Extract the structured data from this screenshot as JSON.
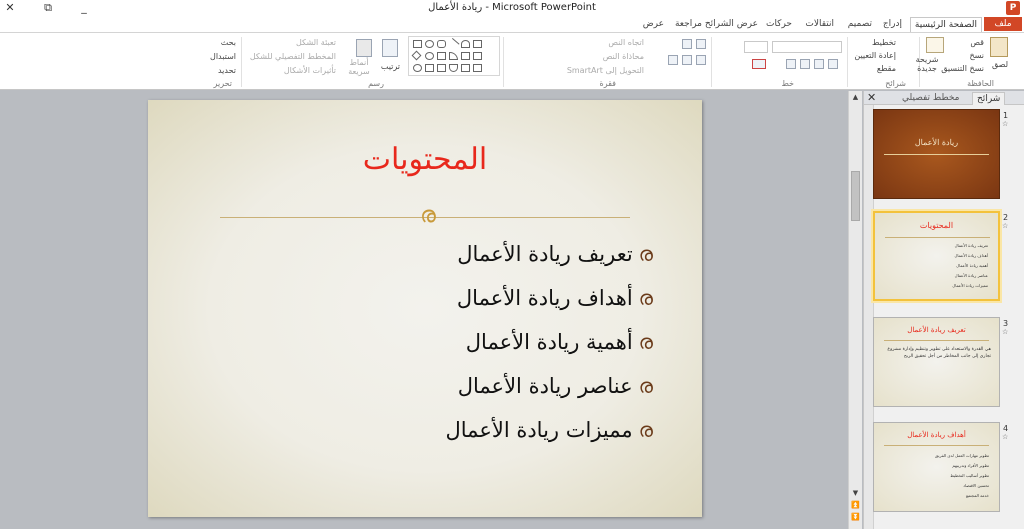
{
  "window": {
    "title": "ريادة الأعمال - Microsoft PowerPoint",
    "app_icon_letter": "P",
    "close_glyph": "✕",
    "restore_glyph": "⧉",
    "minimize_glyph": "_"
  },
  "tabs": [
    "ملف",
    "الصفحة الرئيسية",
    "إدراج",
    "تصميم",
    "انتقالات",
    "حركات",
    "عرض الشرائح",
    "مراجعة",
    "عرض"
  ],
  "ribbon": {
    "clipboard": {
      "label": "الحافظة",
      "paste": "لصق",
      "cut": "قص",
      "copy": "نسخ",
      "format_painter": "نسخ التنسيق"
    },
    "slides": {
      "label": "شرائح",
      "new_slide": "شريحة جديدة",
      "layout": "تخطيط",
      "reset": "إعادة التعيين",
      "section": "مقطع"
    },
    "font": {
      "label": "خط"
    },
    "paragraph": {
      "label": "فقرة",
      "text_direction": "اتجاه النص",
      "align_text": "محاذاة النص",
      "smartart": "التحويل إلى SmartArt"
    },
    "drawing": {
      "label": "رسم",
      "arrange": "ترتيب",
      "quick_styles": "أنماط سريعة",
      "shape_fill": "تعبئة الشكل",
      "shape_outline": "المخطط التفصيلي للشكل",
      "shape_effects": "تأثيرات الأشكال"
    },
    "editing": {
      "label": "تحرير",
      "find": "بحث",
      "replace": "استبدال",
      "select": "تحديد"
    }
  },
  "slide": {
    "title": "المحتويات",
    "ornament": "ര",
    "bullet_glyph": "ര",
    "bullets": [
      "تعريف ريادة الأعمال",
      "أهداف ريادة الأعمال",
      "أهمية ريادة الأعمال",
      "عناصر ريادة الأعمال",
      "مميزات ريادة الأعمال"
    ]
  },
  "pane": {
    "tab_slides": "شرائح",
    "tab_outline": "مخطط تفصيلي",
    "close_glyph": "✕",
    "thumbnails": [
      {
        "num": "1",
        "title": "ريادة الأعمال"
      },
      {
        "num": "2",
        "title": "المحتويات",
        "items": [
          "تعريف ريادة الأعمال",
          "أهداف ريادة الأعمال",
          "أهمية ريادة الأعمال",
          "عناصر ريادة الأعمال",
          "مميزات ريادة الأعمال"
        ]
      },
      {
        "num": "3",
        "title": "تعريف ريادة الأعمال",
        "para": "هي القدرة والاستعداد على تطوير وتنظيم وإدارة مشروع تجاري إلى جانب المخاطر من أجل تحقيق الربح"
      },
      {
        "num": "4",
        "title": "أهداف ريادة الأعمال",
        "items": [
          "تطوير مهارات العمل لدى الفريق",
          "تطوير الأفراد وتدريبهم",
          "تطوير أساليب التخطيط",
          "تحسين الاقتصاد",
          "خدمة المجتمع"
        ]
      }
    ]
  },
  "colors": {
    "title_red": "#e8281c",
    "gold": "#c9b077",
    "accent": "#d24726",
    "selected": "#f3c23c"
  }
}
